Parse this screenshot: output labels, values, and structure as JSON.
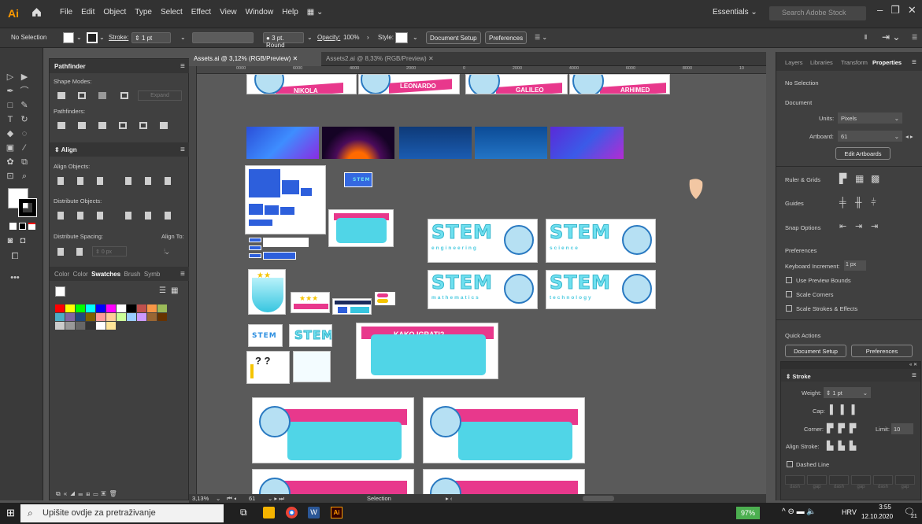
{
  "app": {
    "logo": "Ai",
    "menus": [
      "File",
      "Edit",
      "Object",
      "Type",
      "Select",
      "Effect",
      "View",
      "Window",
      "Help"
    ],
    "workspace": "Essentials",
    "search_placeholder": "Search Adobe Stock"
  },
  "control": {
    "selection": "No Selection",
    "stroke_label": "Stroke:",
    "stroke_value": "1 pt",
    "brush": "3 pt. Round",
    "opacity_label": "Opacity:",
    "opacity_value": "100%",
    "style_label": "Style:",
    "doc_setup": "Document Setup",
    "preferences": "Preferences"
  },
  "pathfinder": {
    "title": "Pathfinder",
    "shape_modes": "Shape Modes:",
    "expand": "Expand",
    "pathfinders": "Pathfinders:"
  },
  "align": {
    "title": "Align",
    "align_objects": "Align Objects:",
    "distribute_objects": "Distribute Objects:",
    "distribute_spacing": "Distribute Spacing:",
    "align_to": "Align To:",
    "spacing_value": "0 px"
  },
  "swatches": {
    "tabs": [
      "Color",
      "Color",
      "Swatches",
      "Brush",
      "Symb"
    ],
    "colors": [
      "#ff0000",
      "#ffff00",
      "#00ff00",
      "#00ffff",
      "#0000ff",
      "#ff00ff",
      "#ffffff",
      "#000000",
      "#c0504d",
      "#f79646",
      "#9bbb59",
      "#4bacc6",
      "#8064a2",
      "#1f497d",
      "#7f6000",
      "#ff9999",
      "#ffcc99",
      "#ccff99",
      "#99ccff",
      "#cc99ff",
      "#996633",
      "#663300",
      "#cccccc",
      "#999999",
      "#666666",
      "#333333",
      "#ffffff",
      "#ffe599"
    ]
  },
  "tabs": [
    {
      "label": "Assets.ai @ 3,12% (RGB/Preview)"
    },
    {
      "label": "Assets2.ai @ 8,33% (RGB/Preview)"
    }
  ],
  "ruler": {
    "h_ticks": [
      "0000",
      "6000",
      "4000",
      "2000",
      "0",
      "2000",
      "4000",
      "6000",
      "8000",
      "10"
    ]
  },
  "canvas": {
    "banners": [
      "NIKOLA",
      "LEONARDO",
      "GALILEO",
      "ARHIMED"
    ],
    "stem_cards": [
      {
        "word": "STEM",
        "sub": "engineering"
      },
      {
        "word": "STEM",
        "sub": "science"
      },
      {
        "word": "STEM",
        "sub": "mathematics"
      },
      {
        "word": "STEM",
        "sub": "technology"
      }
    ],
    "small_stem": [
      "STEM",
      "STEM",
      "STEM"
    ],
    "kako": "KAKO IGRATI?"
  },
  "right_panel": {
    "tabs": [
      "Layers",
      "Libraries",
      "Transform",
      "Properties"
    ],
    "no_selection": "No Selection",
    "document": "Document",
    "units_label": "Units:",
    "units_value": "Pixels",
    "artboard_label": "Artboard:",
    "artboard_value": "61",
    "edit_artboards": "Edit Artboards",
    "ruler_grids": "Ruler & Grids",
    "guides": "Guides",
    "snap_options": "Snap Options",
    "preferences": "Preferences",
    "keyboard_increment_label": "Keyboard Increment:",
    "keyboard_increment_value": "1 px",
    "use_preview_bounds": "Use Preview Bounds",
    "scale_corners": "Scale Corners",
    "scale_strokes": "Scale Strokes & Effects",
    "quick_actions": "Quick Actions",
    "doc_setup": "Document Setup",
    "preferences_btn": "Preferences",
    "stroke_title": "Stroke",
    "weight_label": "Weight:",
    "weight_value": "1 pt",
    "cap_label": "Cap:",
    "corner_label": "Corner:",
    "limit_label": "Limit:",
    "limit_value": "10",
    "align_stroke": "Align Stroke:",
    "dashed_line": "Dashed Line",
    "dash_labels": [
      "dash",
      "gap",
      "dash",
      "gap",
      "dash",
      "gap"
    ]
  },
  "status": {
    "zoom": "3,13%",
    "artboard": "61",
    "tool": "Selection"
  },
  "taskbar": {
    "search": "Upišite ovdje za pretraživanje",
    "battery": "97%",
    "lang": "HRV",
    "time": "3:55",
    "date": "12.10.2020",
    "notif": "21"
  }
}
